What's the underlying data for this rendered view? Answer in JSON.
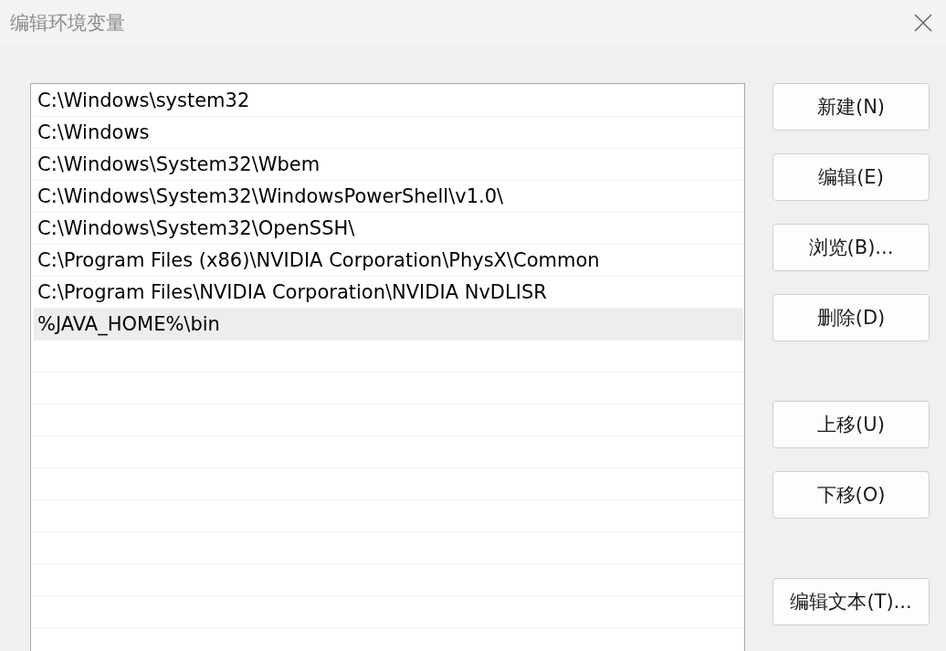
{
  "window": {
    "title": "编辑环境变量"
  },
  "paths": [
    {
      "text": "C:\\Windows\\system32",
      "selected": false
    },
    {
      "text": "C:\\Windows",
      "selected": false
    },
    {
      "text": "C:\\Windows\\System32\\Wbem",
      "selected": false
    },
    {
      "text": "C:\\Windows\\System32\\WindowsPowerShell\\v1.0\\",
      "selected": false
    },
    {
      "text": "C:\\Windows\\System32\\OpenSSH\\",
      "selected": false
    },
    {
      "text": "C:\\Program Files (x86)\\NVIDIA Corporation\\PhysX\\Common",
      "selected": false
    },
    {
      "text": "C:\\Program Files\\NVIDIA Corporation\\NVIDIA NvDLISR",
      "selected": false
    },
    {
      "text": "%JAVA_HOME%\\bin",
      "selected": true
    }
  ],
  "button_groups": [
    [
      "新建(N)",
      "编辑(E)",
      "浏览(B)...",
      "删除(D)"
    ],
    [
      "上移(U)",
      "下移(O)"
    ],
    [
      "编辑文本(T)..."
    ]
  ]
}
